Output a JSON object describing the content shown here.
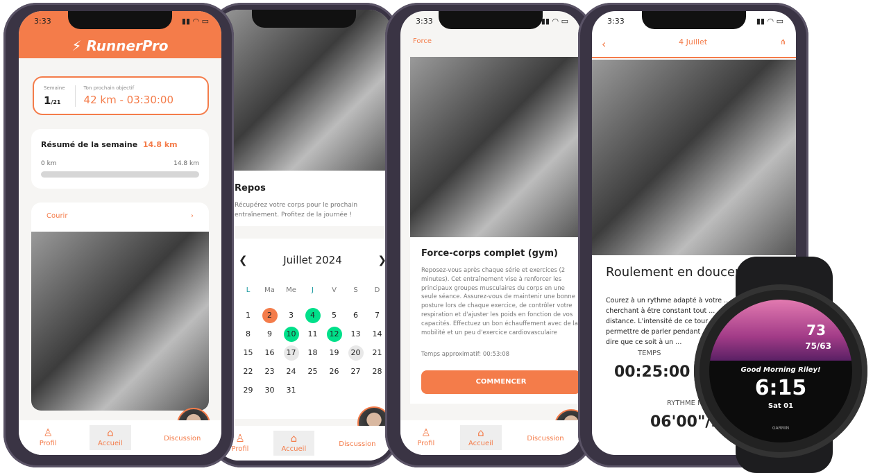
{
  "status_time": "3:33",
  "phone1": {
    "brand": "RunnerPro",
    "week_label": "Semaine",
    "week_current": "1",
    "week_total": "/21",
    "objective_label": "Ton prochain objectif",
    "objective_value": "42 km - 03:30:00",
    "summary_title": "Résumé de la semaine",
    "summary_value": "14.8 km",
    "progress_min": "0 km",
    "progress_max": "14.8 km",
    "progress_fraction": 1.0,
    "activity_label": "Courir"
  },
  "phone2": {
    "title": "Repos",
    "description": "Récupérez votre corps pour le prochain entraînement. Profitez de la journée !",
    "calendar": {
      "month": "Juillet 2024",
      "weekdays": [
        "L",
        "Ma",
        "Me",
        "J",
        "V",
        "S",
        "D"
      ],
      "days": [
        "1",
        "2",
        "3",
        "4",
        "5",
        "6",
        "7",
        "8",
        "9",
        "10",
        "11",
        "12",
        "13",
        "14",
        "15",
        "16",
        "17",
        "18",
        "19",
        "20",
        "21",
        "22",
        "23",
        "24",
        "25",
        "26",
        "27",
        "28",
        "29",
        "30",
        "31"
      ],
      "today": "2",
      "completed": [
        "4",
        "10",
        "12"
      ],
      "upcoming": [
        "17",
        "20"
      ]
    }
  },
  "phone3": {
    "category": "Force",
    "title": "Force-corps complet (gym)",
    "description": "Reposez-vous après chaque série et exercices (2 minutes). Cet entraînement vise à renforcer les principaux groupes musculaires du corps en une seule séance. Assurez-vous de maintenir une bonne posture lors de chaque exercice, de contrôler votre respiration et d'ajuster les poids en fonction de vos capacités. Effectuez un bon échauffement avec de la mobilité et un peu d'exercice cardiovasculaire",
    "time": "Temps approximatif: 00:53:08",
    "start": "COMMENCER"
  },
  "phone4": {
    "date": "4 Juillet",
    "title": "Roulement en douceur",
    "description": "Courez à un rythme adapté à votre ... cherchant à être constant tout ... distance. L'intensité de ce tour ... permettre de parler pendant ... c'est-à-dire que ce soit à un ...",
    "time_label": "TEMPS",
    "time_value": "00:25:00",
    "pace_label": "RYTHME MOYEN",
    "pace_value": "06'00\"/km"
  },
  "nav": {
    "profile": "Profil",
    "home": "Accueil",
    "chat": "Discussion"
  },
  "watch": {
    "temp": "73",
    "temp_range": "75/63",
    "greeting": "Good Morning Riley!",
    "time": "6:15",
    "date": "Sat 01",
    "brand": "GARMIN"
  },
  "colors": {
    "accent": "#f47c4a",
    "completed": "#00e08a",
    "today": "#f47c4a"
  }
}
